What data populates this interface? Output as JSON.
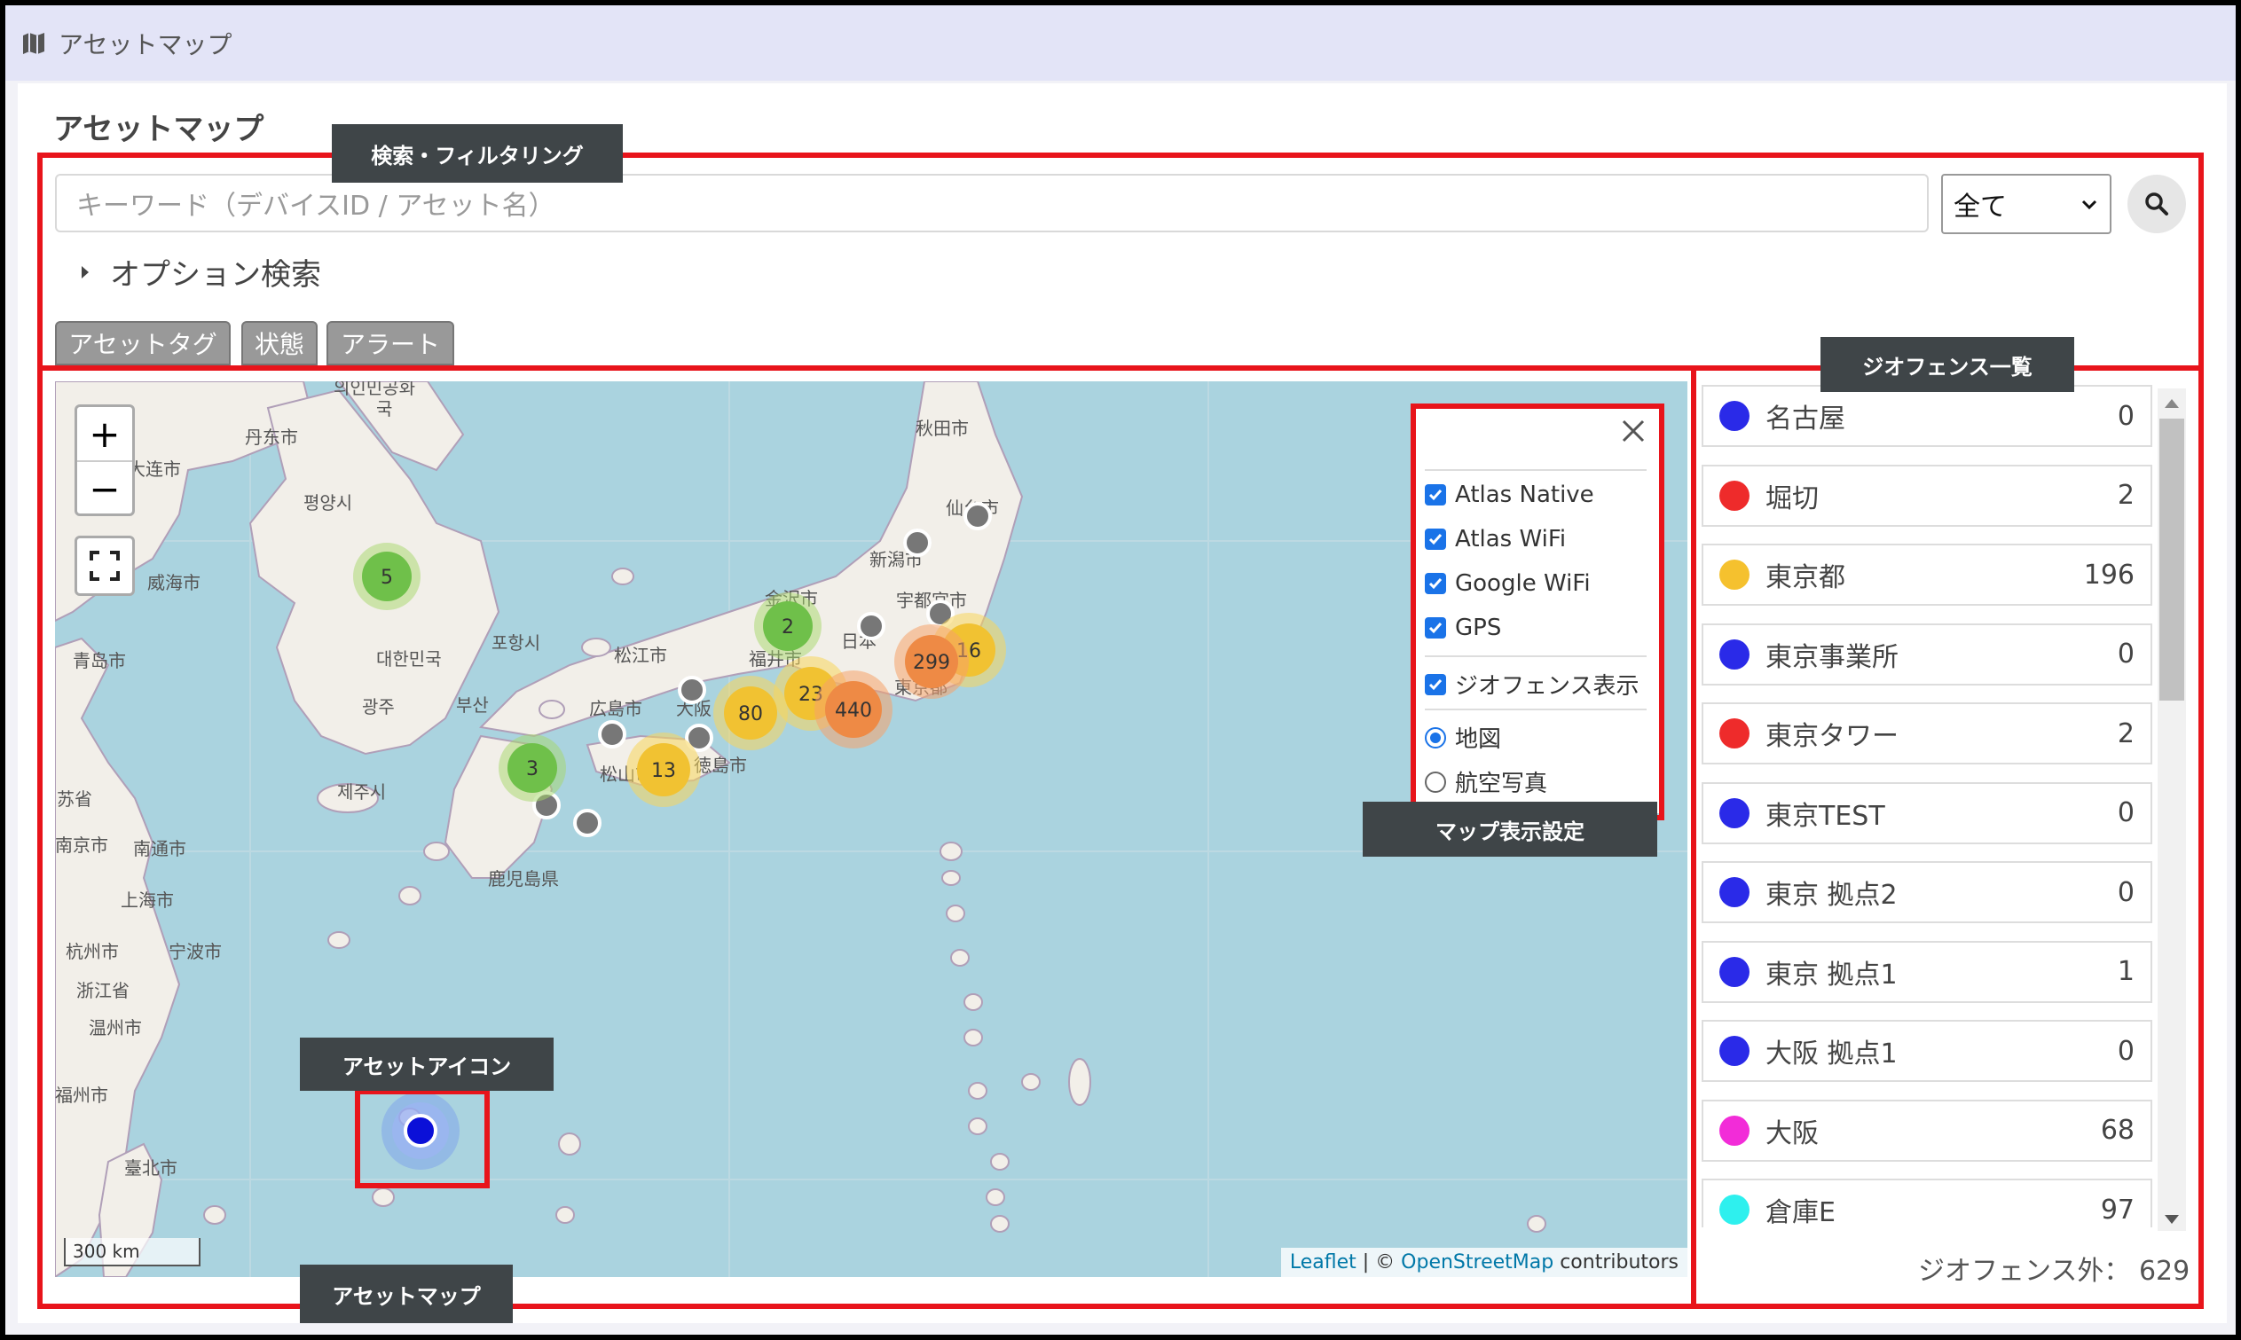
{
  "app": {
    "title": "アセットマップ"
  },
  "page": {
    "title": "アセットマップ"
  },
  "search": {
    "placeholder": "キーワード（デバイスID / アセット名）",
    "scope_selected": "全て",
    "option_search_label": "オプション検索"
  },
  "tabs": [
    {
      "label": "アセットタグ"
    },
    {
      "label": "状態"
    },
    {
      "label": "アラート"
    }
  ],
  "callouts": {
    "search_filter": "検索・フィルタリング",
    "geofence_list": "ジオフェンス一覧",
    "map_settings": "マップ表示設定",
    "asset_icon": "アセットアイコン",
    "asset_map": "アセットマップ"
  },
  "map": {
    "zoom_in": "+",
    "zoom_out": "−",
    "scale_label": "300 km",
    "attribution": {
      "leaflet": "Leaflet",
      "sep": " | © ",
      "osm": "OpenStreetMap",
      "suffix": " contributors"
    },
    "place_labels": [
      "의인민공화",
      "국",
      "丹东市",
      "大连市",
      "평양시",
      "威海市",
      "青岛市",
      "대한민국",
      "포항시",
      "광주",
      "부산",
      "제주시",
      "苏省",
      "南京市",
      "南通市",
      "上海市",
      "杭州市",
      "宁波市",
      "浙江省",
      "温州市",
      "福州市",
      "臺北市",
      "秋田市",
      "新潟市",
      "宇都宮市",
      "日本",
      "東京都",
      "金沢市",
      "福井市",
      "松江市",
      "広島市",
      "大阪",
      "松山市",
      "徳島市",
      "鹿児島県",
      "仙台市"
    ],
    "clusters": [
      {
        "count": "5",
        "color": "green"
      },
      {
        "count": "2",
        "color": "green"
      },
      {
        "count": "3",
        "color": "green"
      },
      {
        "count": "299",
        "color": "orange"
      },
      {
        "count": "16",
        "color": "yellow"
      },
      {
        "count": "23",
        "color": "yellow"
      },
      {
        "count": "440",
        "color": "orange"
      },
      {
        "count": "80",
        "color": "yellow"
      },
      {
        "count": "13",
        "color": "yellow"
      }
    ]
  },
  "map_settings": {
    "layers": [
      {
        "label": "Atlas Native",
        "checked": true
      },
      {
        "label": "Atlas WiFi",
        "checked": true
      },
      {
        "label": "Google WiFi",
        "checked": true
      },
      {
        "label": "GPS",
        "checked": true
      }
    ],
    "geofence_toggle": {
      "label": "ジオフェンス表示",
      "checked": true
    },
    "basemaps": [
      {
        "label": "地図",
        "selected": true
      },
      {
        "label": "航空写真",
        "selected": false
      }
    ]
  },
  "geofences": [
    {
      "name": "名古屋",
      "count": "0",
      "color": "#2a2ae8"
    },
    {
      "name": "堀切",
      "count": "2",
      "color": "#ee2b2b"
    },
    {
      "name": "東京都",
      "count": "196",
      "color": "#f5c12e"
    },
    {
      "name": "東京事業所",
      "count": "0",
      "color": "#2a2ae8"
    },
    {
      "name": "東京タワー",
      "count": "2",
      "color": "#ee2b2b"
    },
    {
      "name": "東京TEST",
      "count": "0",
      "color": "#2a2ae8"
    },
    {
      "name": "東京 拠点2",
      "count": "0",
      "color": "#2a2ae8"
    },
    {
      "name": "東京 拠点1",
      "count": "1",
      "color": "#2a2ae8"
    },
    {
      "name": "大阪 拠点1",
      "count": "0",
      "color": "#2a2ae8"
    },
    {
      "name": "大阪",
      "count": "68",
      "color": "#f22cd8"
    },
    {
      "name": "倉庫E",
      "count": "97",
      "color": "#2ef0ee"
    }
  ],
  "geofence_outside": {
    "label": "ジオフェンス外：",
    "count": "629"
  }
}
